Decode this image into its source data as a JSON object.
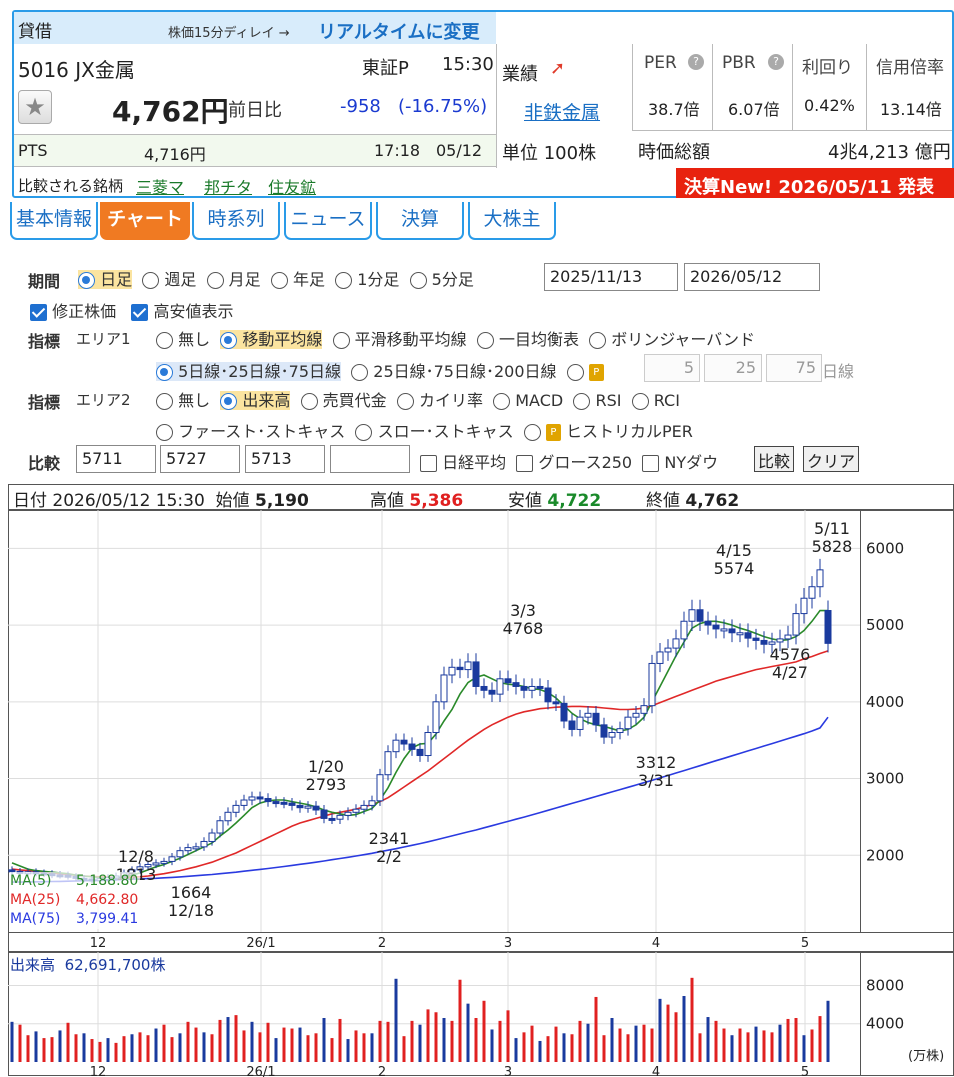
{
  "header": {
    "section": "貸借",
    "delay_note": "株価15分ディレイ →",
    "realtime_link": "リアルタイムに変更",
    "code_name": "5016 JX金属",
    "market": "東証P",
    "time": "15:30",
    "price": "4,762円",
    "prev_label": "前日比",
    "change": "-958",
    "change_pct": "(-16.75%)",
    "pts_label": "PTS",
    "pts_price": "4,716円",
    "pts_time": "17:18",
    "pts_date": "05/12",
    "compare_label": "比較される銘柄",
    "compare_links": [
      "三菱マ",
      "邦チタ",
      "住友鉱"
    ],
    "performance_label": "業績",
    "industry": "非鉄金属",
    "unit": "単位 100株",
    "per_label": "PER",
    "per": "38.7倍",
    "pbr_label": "PBR",
    "pbr": "6.07倍",
    "yield_label": "利回り",
    "yield": "0.42%",
    "margin_label": "信用倍率",
    "margin": "13.14倍",
    "mcap_label": "時価総額",
    "mcap": "4兆4,213 億円",
    "earnings_banner": "決算New! 2026/05/11 発表"
  },
  "tabs": [
    "基本情報",
    "チャート",
    "時系列",
    "ニュース",
    "決算",
    "大株主"
  ],
  "form": {
    "period_label": "期間",
    "periods": [
      "日足",
      "週足",
      "月足",
      "年足",
      "1分足",
      "5分足"
    ],
    "date_from": "2025/11/13",
    "date_to": "2026/05/12",
    "adjusted": "修正株価",
    "show_hilo": "高安値表示",
    "indicator_label": "指標",
    "area1": "エリア1",
    "area1_opts": [
      "無し",
      "移動平均線",
      "平滑移動平均線",
      "一目均衡表",
      "ボリンジャーバンド"
    ],
    "ma_opts": [
      "5日線･25日線･75日線",
      "25日線･75日線･200日線"
    ],
    "custom_ma": [
      "5",
      "25",
      "75"
    ],
    "custom_unit": "日線",
    "area2": "エリア2",
    "area2_opts": [
      "無し",
      "出来高",
      "売買代金",
      "カイリ率",
      "MACD",
      "RSI",
      "RCI"
    ],
    "area2_opts2": [
      "ファースト･ストキャス",
      "スロー･ストキャス",
      "ヒストリカルPER"
    ],
    "compare_label": "比較",
    "compare_codes": [
      "5711",
      "5727",
      "5713",
      ""
    ],
    "compare_checks": [
      "日経平均",
      "グロース250",
      "NYダウ"
    ],
    "compare_btn": "比較",
    "clear_btn": "クリア"
  },
  "chart_info": {
    "date_label": "日付",
    "date": "2026/05/12 15:30",
    "open_label": "始値",
    "open": "5,190",
    "high_label": "高値",
    "high": "5,386",
    "low_label": "安値",
    "low": "4,722",
    "close_label": "終値",
    "close": "4,762"
  },
  "legend": {
    "ma5": "MA(5)",
    "ma5_val": "5,188.80",
    "ma25": "MA(25)",
    "ma25_val": "4,662.80",
    "ma75": "MA(75)",
    "ma75_val": "3,799.41"
  },
  "volume_info": {
    "label": "出来高",
    "value": "62,691,700株",
    "unit": "(万株)"
  },
  "colors": {
    "up": "#1a3a9e",
    "down": "#e02020",
    "ma5": "#2a8a2a",
    "ma25": "#e02828",
    "ma75": "#2a3ae0",
    "accent": "#2a9be8"
  },
  "chart_data": {
    "type": "line",
    "price_axis": {
      "ticks": [
        2000,
        3000,
        4000,
        5000,
        6000
      ]
    },
    "volume_axis": {
      "ticks": [
        4000,
        8000
      ]
    },
    "x_ticks": [
      "12",
      "26/1",
      "2",
      "3",
      "4",
      "5"
    ],
    "annotations": [
      {
        "date": "12/8",
        "value": "1813"
      },
      {
        "date": "12/18",
        "value": "1664"
      },
      {
        "date": "1/20",
        "value": "2793"
      },
      {
        "date": "2/2",
        "value": "2341"
      },
      {
        "date": "3/3",
        "value": "4768"
      },
      {
        "date": "3/31",
        "value": "3312"
      },
      {
        "date": "4/15",
        "value": "5574"
      },
      {
        "date": "4/27",
        "value": "4576"
      },
      {
        "date": "5/11",
        "value": "5828"
      }
    ],
    "close": [
      1790,
      1775,
      1785,
      1770,
      1760,
      1745,
      1740,
      1725,
      1700,
      1690,
      1680,
      1695,
      1710,
      1730,
      1770,
      1810,
      1850,
      1880,
      1900,
      1920,
      1980,
      2060,
      2100,
      2110,
      2180,
      2290,
      2450,
      2560,
      2650,
      2720,
      2760,
      2740,
      2700,
      2690,
      2680,
      2650,
      2620,
      2640,
      2590,
      2480,
      2470,
      2520,
      2560,
      2600,
      2650,
      2710,
      3050,
      3350,
      3500,
      3450,
      3380,
      3300,
      3600,
      4000,
      4350,
      4450,
      4420,
      4520,
      4200,
      4150,
      4100,
      4300,
      4250,
      4200,
      4150,
      4200,
      4180,
      4000,
      3980,
      3750,
      3640,
      3800,
      3850,
      3700,
      3540,
      3600,
      3650,
      3800,
      3850,
      3950,
      4500,
      4650,
      4700,
      4820,
      5050,
      5200,
      5050,
      5000,
      4950,
      4950,
      4900,
      4900,
      4830,
      4800,
      4750,
      4780,
      4820,
      4870,
      5150,
      5350,
      5500,
      5720,
      4762
    ],
    "open": [
      1810,
      1790,
      1775,
      1785,
      1770,
      1760,
      1745,
      1740,
      1725,
      1700,
      1690,
      1680,
      1695,
      1710,
      1730,
      1770,
      1810,
      1850,
      1880,
      1900,
      1920,
      1980,
      2060,
      2100,
      2110,
      2180,
      2290,
      2450,
      2560,
      2650,
      2720,
      2760,
      2740,
      2700,
      2690,
      2680,
      2650,
      2620,
      2640,
      2590,
      2480,
      2470,
      2520,
      2560,
      2600,
      2650,
      2710,
      3050,
      3350,
      3500,
      3450,
      3380,
      3300,
      3600,
      4000,
      4350,
      4450,
      4420,
      4520,
      4200,
      4150,
      4100,
      4300,
      4250,
      4200,
      4150,
      4200,
      4180,
      4000,
      3980,
      3750,
      3640,
      3800,
      3850,
      3700,
      3540,
      3600,
      3650,
      3800,
      3850,
      3950,
      4500,
      4650,
      4700,
      4820,
      5050,
      5200,
      5050,
      5000,
      4950,
      4950,
      4900,
      4900,
      4830,
      4800,
      4750,
      4780,
      4820,
      4870,
      5150,
      5350,
      5500,
      5190
    ],
    "ma5": [
      1900,
      1860,
      1820,
      1800,
      1790,
      1780,
      1770,
      1760,
      1740,
      1730,
      1720,
      1710,
      1705,
      1705,
      1715,
      1740,
      1770,
      1810,
      1850,
      1880,
      1920,
      1960,
      2010,
      2060,
      2110,
      2160,
      2250,
      2330,
      2420,
      2520,
      2620,
      2680,
      2710,
      2720,
      2720,
      2700,
      2680,
      2660,
      2630,
      2590,
      2560,
      2540,
      2520,
      2530,
      2570,
      2610,
      2720,
      2880,
      3080,
      3260,
      3400,
      3450,
      3460,
      3580,
      3750,
      3900,
      4100,
      4250,
      4320,
      4350,
      4300,
      4250,
      4230,
      4220,
      4200,
      4170,
      4160,
      4120,
      4050,
      3950,
      3850,
      3780,
      3730,
      3700,
      3680,
      3650,
      3620,
      3640,
      3700,
      3800,
      4000,
      4200,
      4400,
      4600,
      4780,
      4960,
      5020,
      5050,
      5050,
      5030,
      5000,
      4960,
      4930,
      4890,
      4850,
      4820,
      4800,
      4810,
      4850,
      4930,
      5050,
      5190,
      5189
    ],
    "ma25": [
      1820,
      1810,
      1800,
      1790,
      1780,
      1770,
      1760,
      1750,
      1740,
      1730,
      1725,
      1720,
      1715,
      1712,
      1712,
      1715,
      1720,
      1730,
      1745,
      1760,
      1780,
      1800,
      1825,
      1850,
      1880,
      1910,
      1950,
      1990,
      2030,
      2080,
      2130,
      2180,
      2230,
      2280,
      2330,
      2380,
      2420,
      2450,
      2480,
      2510,
      2540,
      2560,
      2580,
      2600,
      2630,
      2660,
      2700,
      2750,
      2820,
      2890,
      2960,
      3030,
      3100,
      3180,
      3260,
      3340,
      3420,
      3500,
      3570,
      3640,
      3700,
      3750,
      3800,
      3840,
      3870,
      3890,
      3910,
      3920,
      3930,
      3935,
      3940,
      3940,
      3935,
      3930,
      3920,
      3910,
      3900,
      3900,
      3905,
      3920,
      3950,
      3990,
      4030,
      4070,
      4110,
      4150,
      4190,
      4230,
      4270,
      4300,
      4330,
      4360,
      4390,
      4420,
      4440,
      4460,
      4480,
      4500,
      4520,
      4560,
      4590,
      4630,
      4663
    ],
    "ma75": [
      1650,
      1650,
      1652,
      1654,
      1656,
      1658,
      1660,
      1662,
      1665,
      1668,
      1670,
      1673,
      1676,
      1680,
      1684,
      1688,
      1692,
      1696,
      1700,
      1706,
      1712,
      1718,
      1726,
      1734,
      1742,
      1750,
      1760,
      1770,
      1780,
      1792,
      1804,
      1816,
      1828,
      1840,
      1854,
      1868,
      1882,
      1896,
      1910,
      1926,
      1942,
      1958,
      1974,
      1990,
      2008,
      2026,
      2046,
      2066,
      2086,
      2108,
      2130,
      2152,
      2176,
      2200,
      2226,
      2252,
      2278,
      2304,
      2330,
      2358,
      2386,
      2414,
      2442,
      2470,
      2498,
      2526,
      2556,
      2586,
      2616,
      2646,
      2676,
      2706,
      2736,
      2766,
      2796,
      2826,
      2856,
      2886,
      2916,
      2946,
      2976,
      3008,
      3040,
      3072,
      3104,
      3136,
      3168,
      3200,
      3232,
      3264,
      3296,
      3328,
      3360,
      3392,
      3424,
      3456,
      3488,
      3520,
      3552,
      3584,
      3620,
      3660,
      3799
    ],
    "volume": [
      4200,
      3900,
      2800,
      3200,
      2500,
      2600,
      3300,
      4100,
      2900,
      3000,
      2400,
      2100,
      2500,
      2000,
      2700,
      2900,
      3100,
      2800,
      3500,
      3900,
      2600,
      3000,
      4200,
      3600,
      3100,
      2900,
      4400,
      4700,
      4900,
      3300,
      4200,
      3100,
      4100,
      2500,
      3600,
      3500,
      3600,
      2800,
      3000,
      4600,
      2500,
      4500,
      2400,
      3300,
      3000,
      3000,
      4300,
      4200,
      8700,
      2700,
      4300,
      3900,
      5500,
      5200,
      4600,
      4300,
      8600,
      6100,
      4600,
      6400,
      3400,
      4300,
      5400,
      2500,
      3100,
      3800,
      2200,
      2700,
      3700,
      3000,
      2900,
      4300,
      4000,
      6800,
      2800,
      4600,
      3500,
      2900,
      3800,
      3900,
      3500,
      6600,
      6000,
      5200,
      6900,
      8800,
      3000,
      4700,
      4300,
      3500,
      2800,
      3500,
      3100,
      3700,
      3300,
      3100,
      3900,
      4500,
      4600,
      2800,
      3400,
      4800,
      6400
    ]
  }
}
